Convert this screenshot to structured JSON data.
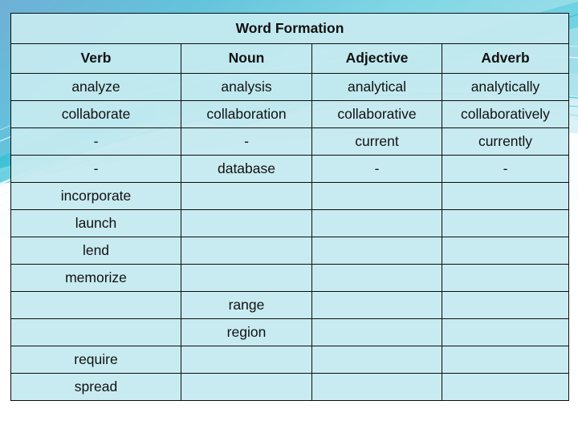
{
  "slide": {
    "title": "Word Formation",
    "accent_red": "#b02a2a",
    "text_black": "#111111",
    "cell_fill": "#c5eaf0",
    "border_color": "#0d0d0d",
    "background_top": "#6fb4d8",
    "background_swoosh": "#3fc8d8"
  },
  "table": {
    "columns": [
      {
        "key": "verb",
        "label": "Verb"
      },
      {
        "key": "noun",
        "label": "Noun"
      },
      {
        "key": "adjective",
        "label": "Adjective"
      },
      {
        "key": "adverb",
        "label": "Adverb"
      }
    ],
    "rows": [
      {
        "verb": "analyze",
        "verb_color": "black",
        "noun": "analysis",
        "noun_color": "red",
        "adjective": "analytical",
        "adjective_color": "red",
        "adverb": "analytically",
        "adverb_color": "red"
      },
      {
        "verb": "collaborate",
        "verb_color": "black",
        "noun": "collaboration",
        "noun_color": "red",
        "adjective": "collaborative",
        "adjective_color": "red",
        "adverb": "collaboratively",
        "adverb_color": "red"
      },
      {
        "verb": "-",
        "verb_color": "red",
        "noun": "-",
        "noun_color": "red",
        "adjective": "current",
        "adjective_color": "black",
        "adverb": "currently",
        "adverb_color": "red"
      },
      {
        "verb": "-",
        "verb_color": "red",
        "noun": "database",
        "noun_color": "black",
        "adjective": "-",
        "adjective_color": "red",
        "adverb": "-",
        "adverb_color": "red"
      },
      {
        "verb": "incorporate",
        "verb_color": "black",
        "noun": "",
        "noun_color": "black",
        "adjective": "",
        "adjective_color": "black",
        "adverb": "",
        "adverb_color": "black"
      },
      {
        "verb": "launch",
        "verb_color": "black",
        "noun": "",
        "noun_color": "black",
        "adjective": "",
        "adjective_color": "black",
        "adverb": "",
        "adverb_color": "black"
      },
      {
        "verb": "lend",
        "verb_color": "black",
        "noun": "",
        "noun_color": "black",
        "adjective": "",
        "adjective_color": "black",
        "adverb": "",
        "adverb_color": "black"
      },
      {
        "verb": "memorize",
        "verb_color": "black",
        "noun": "",
        "noun_color": "black",
        "adjective": "",
        "adjective_color": "black",
        "adverb": "",
        "adverb_color": "black"
      },
      {
        "verb": "",
        "verb_color": "black",
        "noun": "range",
        "noun_color": "black",
        "adjective": "",
        "adjective_color": "black",
        "adverb": "",
        "adverb_color": "black"
      },
      {
        "verb": "",
        "verb_color": "black",
        "noun": "region",
        "noun_color": "black",
        "adjective": "",
        "adjective_color": "black",
        "adverb": "",
        "adverb_color": "black"
      },
      {
        "verb": "require",
        "verb_color": "black",
        "noun": "",
        "noun_color": "black",
        "adjective": "",
        "adjective_color": "black",
        "adverb": "",
        "adverb_color": "black"
      },
      {
        "verb": "spread",
        "verb_color": "black",
        "noun": "",
        "noun_color": "black",
        "adjective": "",
        "adjective_color": "black",
        "adverb": "",
        "adverb_color": "black"
      }
    ]
  }
}
